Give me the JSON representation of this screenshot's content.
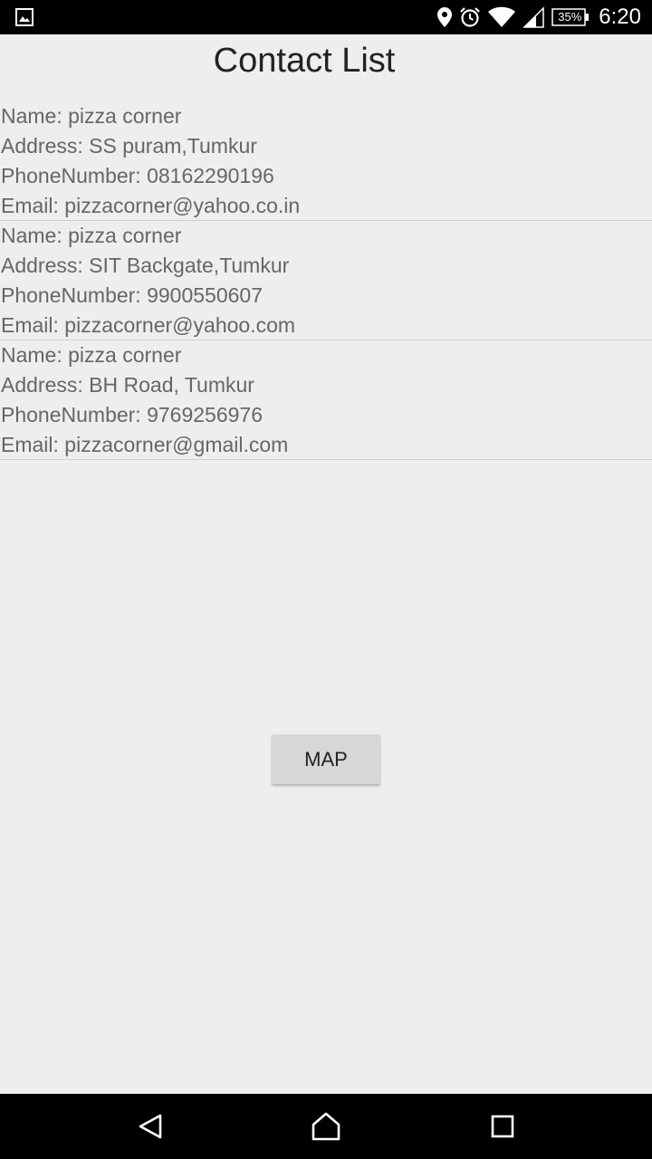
{
  "status_bar": {
    "battery_level": "35%",
    "time": "6:20",
    "icons": [
      "image-notification-icon",
      "location-icon",
      "alarm-icon",
      "wifi-icon",
      "cellular-signal-icon",
      "battery-icon"
    ]
  },
  "screen": {
    "title": "Contact List"
  },
  "contacts": [
    {
      "name": "Name: pizza corner",
      "address": "Address: SS puram,Tumkur",
      "phone": "PhoneNumber: 08162290196",
      "email": "Email: pizzacorner@yahoo.co.in"
    },
    {
      "name": "Name: pizza corner",
      "address": "Address: SIT Backgate,Tumkur",
      "phone": "PhoneNumber: 9900550607",
      "email": "Email: pizzacorner@yahoo.com"
    },
    {
      "name": "Name: pizza corner",
      "address": "Address: BH Road, Tumkur",
      "phone": "PhoneNumber: 9769256976",
      "email": "Email: pizzacorner@gmail.com"
    }
  ],
  "map_button": {
    "label": "MAP"
  },
  "nav_bar": {
    "buttons": [
      "back-icon",
      "home-icon",
      "recents-icon"
    ]
  }
}
